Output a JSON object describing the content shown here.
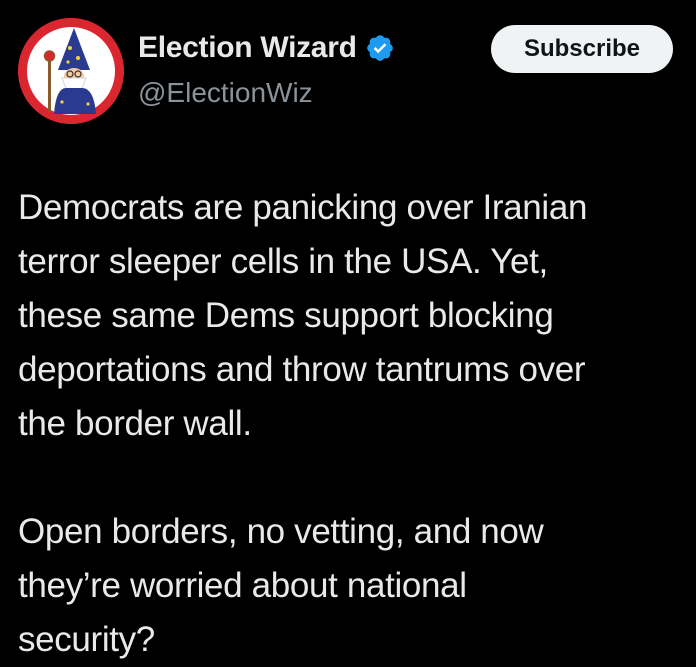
{
  "account": {
    "display_name": "Election Wizard",
    "handle": "@ElectionWiz",
    "verified_icon": "verified-badge-icon",
    "avatar_icon": "wizard-avatar"
  },
  "subscribe_label": "Subscribe",
  "post": {
    "paragraph1": [
      "Democrats are panicking over Iranian",
      "terror sleeper cells in the USA. Yet,",
      "these same Dems support blocking",
      "deportations and throw tantrums over",
      "the border wall."
    ],
    "paragraph2": [
      "Open borders, no vetting, and now",
      "they’re worried about national",
      "security?"
    ]
  },
  "colors": {
    "background": "#000000",
    "text": "#e7e9ea",
    "handle": "#8b9298",
    "verified": "#1d9bf0",
    "avatar_bg": "#d9262f"
  }
}
